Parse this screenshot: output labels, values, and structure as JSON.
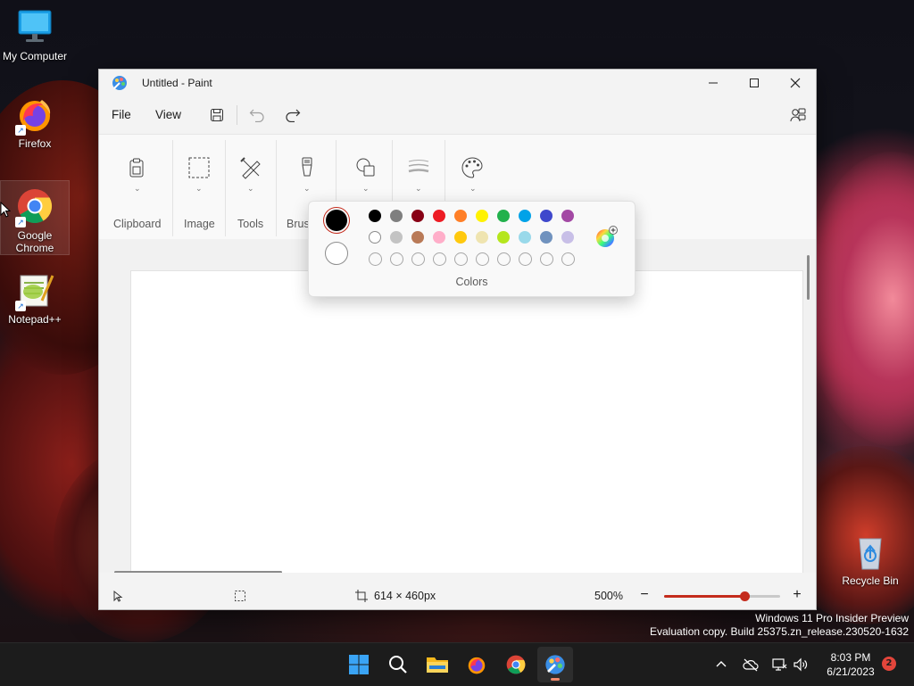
{
  "desktop": {
    "icons": [
      {
        "label": "My Computer",
        "icon": "monitor-icon"
      },
      {
        "label": "Firefox",
        "icon": "firefox-icon"
      },
      {
        "label": "Google Chrome",
        "icon": "chrome-icon"
      },
      {
        "label": "Notepad++",
        "icon": "notepadpp-icon"
      },
      {
        "label": "Recycle Bin",
        "icon": "recycle-bin-icon"
      }
    ],
    "watermark": {
      "line1": "Windows 11 Pro Insider Preview",
      "line2": "Evaluation copy. Build 25375.zn_release.230520-1632"
    }
  },
  "window": {
    "title": "Untitled - Paint",
    "menu": {
      "file": "File",
      "view": "View"
    },
    "ribbon": {
      "groups": [
        {
          "label": "Clipboard",
          "icon": "clipboard-icon"
        },
        {
          "label": "Image",
          "icon": "selection-icon"
        },
        {
          "label": "Tools",
          "icon": "tools-icon"
        },
        {
          "label": "Brushes",
          "icon": "brush-icon"
        },
        {
          "label": "",
          "icon": "shapes-icon"
        },
        {
          "label": "",
          "icon": "stroke-size-icon"
        },
        {
          "label": "",
          "icon": "palette-icon"
        }
      ]
    },
    "status": {
      "canvas_size": "614 × 460px",
      "zoom": "500%",
      "zoom_level": 0.69
    }
  },
  "colors_flyout": {
    "label": "Colors",
    "primary_color": "#000000",
    "secondary_color": "#ffffff",
    "palette_row1": [
      "#000000",
      "#7f7f7f",
      "#880015",
      "#ed1c24",
      "#ff7f27",
      "#fff200",
      "#22b14c",
      "#00a2e8",
      "#3f48cc",
      "#a349a4"
    ],
    "palette_row2": [
      "#ffffff",
      "#c3c3c3",
      "#b97a57",
      "#ffaec9",
      "#ffc90e",
      "#efe4b0",
      "#b5e61d",
      "#99d9ea",
      "#7092be",
      "#c8bfe7"
    ],
    "palette_row3_custom_count": 10
  },
  "taskbar": {
    "clock_time": "8:03 PM",
    "clock_date": "6/21/2023",
    "notification_count": "2"
  }
}
